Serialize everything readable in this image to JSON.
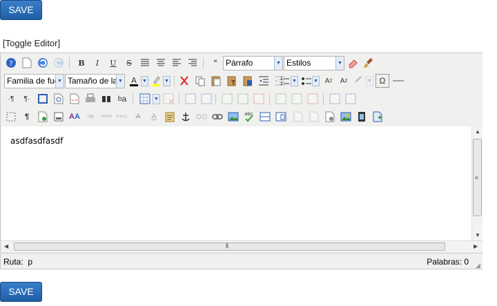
{
  "save_top_label": "SAVE",
  "save_bottom_label": "SAVE",
  "toggle_editor": "[Toggle Editor]",
  "toolbar": {
    "format_select": "Párrafo",
    "styles_select": "Estilos",
    "font_family_select": "Familia de fuen",
    "font_size_select": "Tamaño de la fu"
  },
  "editor": {
    "content": "asdfasdfasdf"
  },
  "status": {
    "path_label": "Ruta:",
    "path_value": "p",
    "word_count": "Palabras: 0"
  },
  "colors": {
    "save_button": "#2a6cb4",
    "toolbar_bg": "#f0f0ee"
  }
}
